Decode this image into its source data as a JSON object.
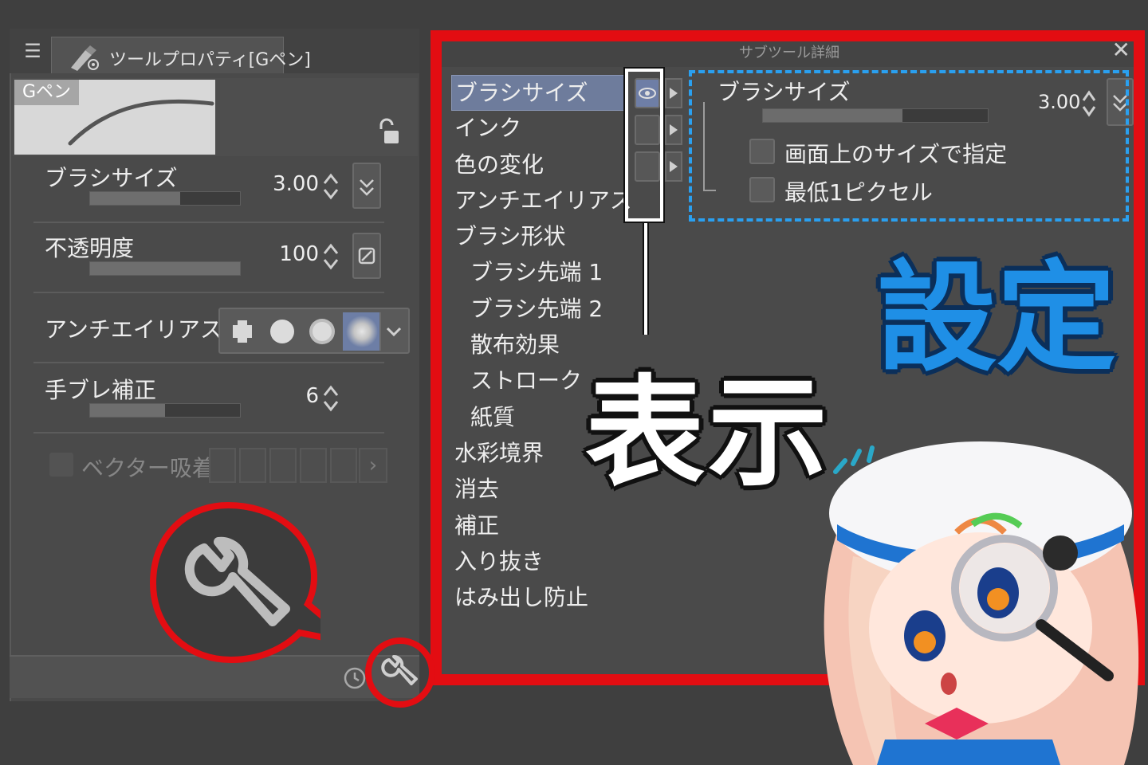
{
  "tool_property": {
    "menu_icon": "hamburger-menu-icon",
    "tab_label": "ツールプロパティ[Gペン]",
    "brush_name": "Gペン",
    "properties": [
      {
        "label": "ブラシサイズ",
        "value": "3.00",
        "fill": 0.6
      },
      {
        "label": "不透明度",
        "value": "100",
        "fill": 1.0
      },
      {
        "label": "手ブレ補正",
        "value": "6",
        "fill": 0.5
      }
    ],
    "antialias_label": "アンチエイリアス",
    "antialias_selected": 3,
    "vector_label": "ベクター吸着"
  },
  "sub_tool_detail": {
    "title": "サブツール詳細",
    "categories": [
      {
        "label": "ブラシサイズ",
        "active": true,
        "sub": false
      },
      {
        "label": "インク",
        "sub": false
      },
      {
        "label": "色の変化",
        "sub": false
      },
      {
        "label": "アンチエイリアス",
        "sub": false
      },
      {
        "label": "ブラシ形状",
        "sub": false
      },
      {
        "label": "ブラシ先端 1",
        "sub": true
      },
      {
        "label": "ブラシ先端 2",
        "sub": true
      },
      {
        "label": "散布効果",
        "sub": true
      },
      {
        "label": "ストローク",
        "sub": true
      },
      {
        "label": "紙質",
        "sub": true
      },
      {
        "label": "水彩境界",
        "sub": false
      },
      {
        "label": "消去",
        "sub": false
      },
      {
        "label": "補正",
        "sub": false
      },
      {
        "label": "入り抜き",
        "sub": false
      },
      {
        "label": "はみ出し防止",
        "sub": false
      }
    ],
    "setting_label": "ブラシサイズ",
    "setting_value": "3.00",
    "setting_fill": 0.62,
    "options": [
      {
        "label": "画面上のサイズで指定",
        "checked": false
      },
      {
        "label": "最低1ピクセル",
        "checked": false
      }
    ]
  },
  "annotations": {
    "display_label": "表示",
    "settings_label": "設定",
    "frame_color": "#e30d12",
    "settings_color": "#1f8fe6"
  }
}
